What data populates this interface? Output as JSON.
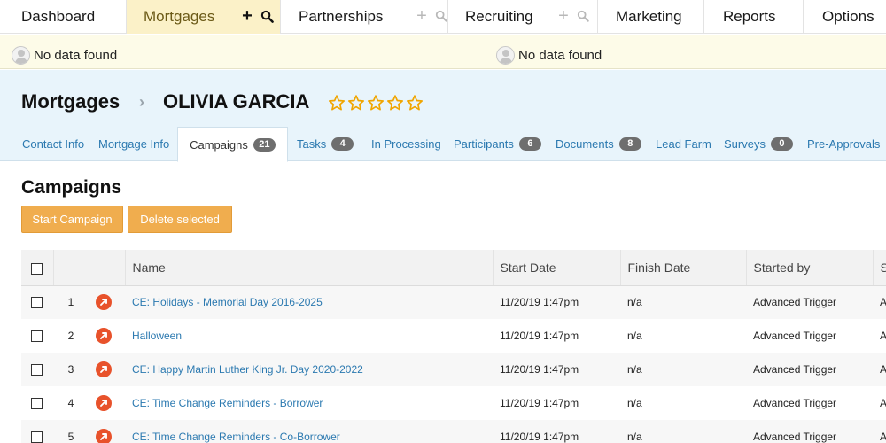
{
  "topnav": {
    "tabs": [
      {
        "label": "Dashboard"
      },
      {
        "label": "Mortgages"
      },
      {
        "label": "Partnerships"
      },
      {
        "label": "Recruiting"
      },
      {
        "label": "Marketing"
      },
      {
        "label": "Reports"
      },
      {
        "label": "Options"
      }
    ],
    "active": "Mortgages"
  },
  "nodata": {
    "left": "No data found",
    "right": "No data found"
  },
  "record": {
    "section": "Mortgages",
    "name": "OLIVIA GARCIA",
    "rating_stars": 5,
    "rating_filled": 0
  },
  "subtabs": [
    {
      "label": "Contact Info"
    },
    {
      "label": "Mortgage Info"
    },
    {
      "label": "Campaigns",
      "count": "21"
    },
    {
      "label": "Tasks",
      "count": "4"
    },
    {
      "label": "In Processing"
    },
    {
      "label": "Participants",
      "count": "6"
    },
    {
      "label": "Documents",
      "count": "8"
    },
    {
      "label": "Lead Farm"
    },
    {
      "label": "Surveys",
      "count": "0"
    },
    {
      "label": "Pre-Approvals"
    }
  ],
  "active_subtab": "Campaigns",
  "campaigns": {
    "heading": "Campaigns",
    "start_button": "Start Campaign",
    "delete_button": "Delete selected",
    "columns": [
      "Name",
      "Start Date",
      "Finish Date",
      "Started by",
      "S"
    ],
    "rows": [
      {
        "num": "1",
        "name": "CE: Holidays - Memorial Day 2016-2025",
        "start": "11/20/19 1:47pm",
        "finish": "n/a",
        "started_by": "Advanced Trigger",
        "extra": "A"
      },
      {
        "num": "2",
        "name": "Halloween",
        "start": "11/20/19 1:47pm",
        "finish": "n/a",
        "started_by": "Advanced Trigger",
        "extra": "A"
      },
      {
        "num": "3",
        "name": "CE: Happy Martin Luther King Jr. Day 2020-2022",
        "start": "11/20/19 1:47pm",
        "finish": "n/a",
        "started_by": "Advanced Trigger",
        "extra": "A"
      },
      {
        "num": "4",
        "name": "CE: Time Change Reminders - Borrower",
        "start": "11/20/19 1:47pm",
        "finish": "n/a",
        "started_by": "Advanced Trigger",
        "extra": "A"
      },
      {
        "num": "5",
        "name": "CE: Time Change Reminders - Co-Borrower",
        "start": "11/20/19 1:47pm",
        "finish": "n/a",
        "started_by": "Advanced Trigger",
        "extra": "A"
      }
    ]
  },
  "colors": {
    "accent_orange": "#f0ad4e",
    "link_blue": "#2b79b0",
    "active_tab_bg": "#fbf1c8",
    "header_bg": "#e8f4fb",
    "campaign_icon": "#e8522b",
    "star": "#f0a500"
  }
}
